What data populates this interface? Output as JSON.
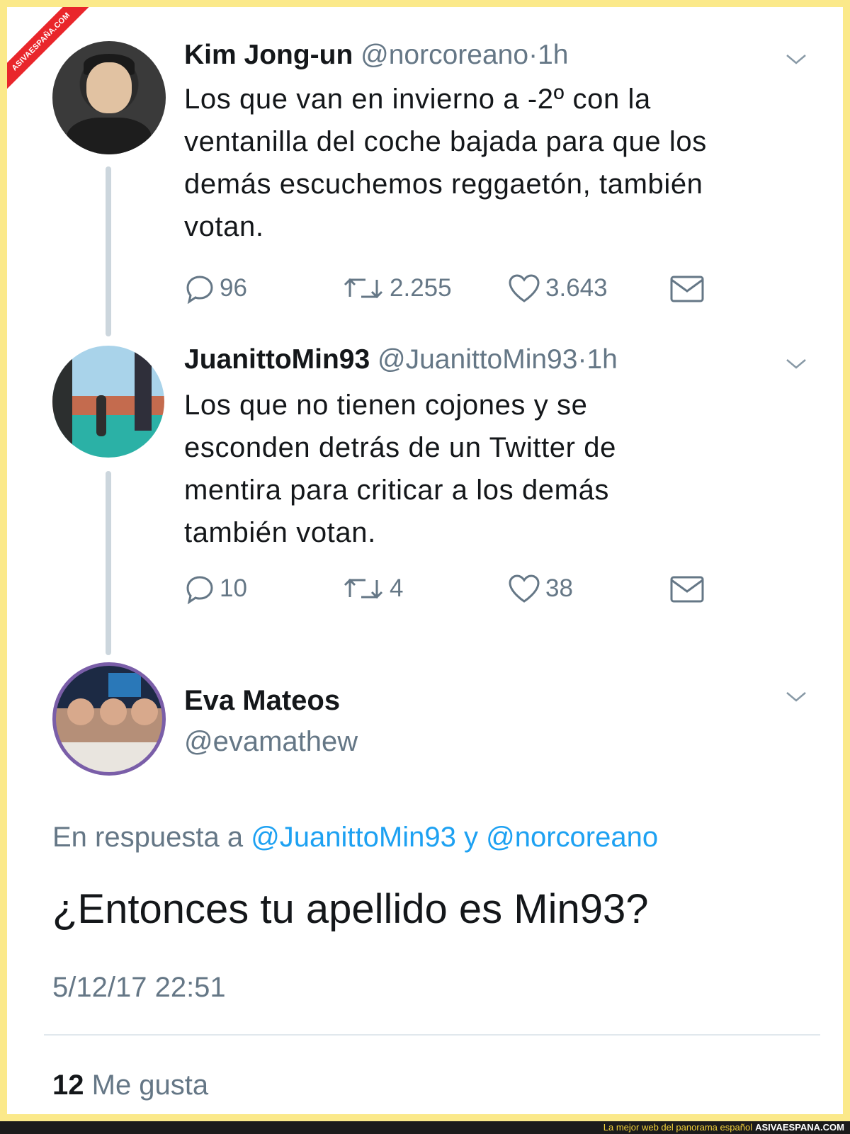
{
  "watermark": {
    "ribbon_text": "ASIVAESPAÑA.COM"
  },
  "tweets": [
    {
      "name": "Kim Jong-un",
      "handle": "@norcoreano",
      "separator": "·",
      "time": "1h",
      "lines": [
        "Los que van en invierno a -2º con la",
        "ventanilla del coche bajada para que los",
        "demás escuchemos reggaetón, también",
        "votan."
      ],
      "replies": "96",
      "retweets": "2.255",
      "likes": "3.643"
    },
    {
      "name": "JuanittoMin93",
      "handle": "@JuanittoMin93",
      "separator": "·",
      "time": "1h",
      "lines": [
        "Los que no tienen cojones y se",
        "esconden detrás de un Twitter de",
        "mentira para criticar a los demás",
        "también votan."
      ],
      "replies": "10",
      "retweets": "4",
      "likes": "38"
    }
  ],
  "main_tweet": {
    "name": "Eva Mateos",
    "handle": "@evamathew",
    "reply_prefix": "En respuesta a",
    "reply_to_1": "@JuanittoMin93",
    "reply_joiner": "y",
    "reply_to_2": "@norcoreano",
    "text": "¿Entonces tu apellido es Min93?",
    "timestamp": "5/12/17 22:51",
    "likes_count": "12",
    "likes_label": "Me gusta"
  },
  "footer": {
    "slogan": "La mejor web del panorama español",
    "site": "ASIVAESPANA.COM"
  },
  "icons": [
    "reply-icon",
    "retweet-icon",
    "heart-icon",
    "message-icon",
    "chevron-down-icon"
  ],
  "colors": {
    "border": "#fbe98a",
    "link": "#1da1f2",
    "muted": "#657786",
    "ribbon": "#e9262b"
  }
}
